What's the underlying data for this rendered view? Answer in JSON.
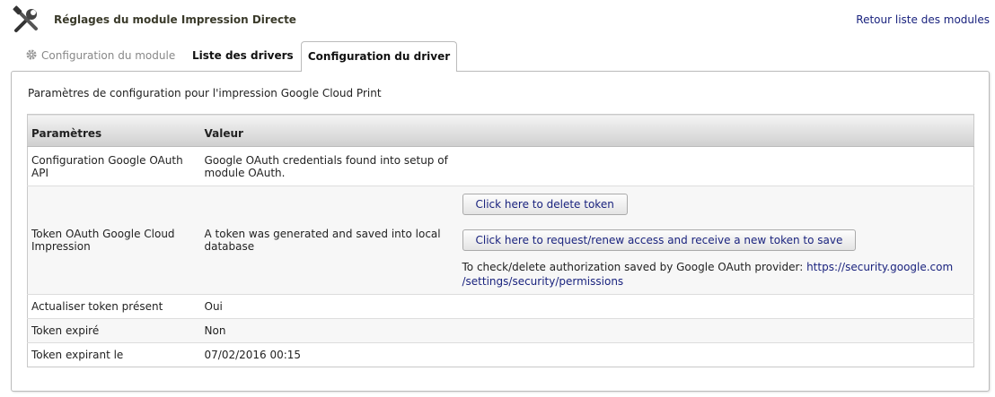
{
  "header": {
    "title": "Réglages du module Impression Directe",
    "back_link": "Retour liste des modules"
  },
  "tabs": [
    {
      "label": "Configuration du module",
      "state": "disabled",
      "icon": "gear-icon"
    },
    {
      "label": "Liste des drivers",
      "state": "inactive"
    },
    {
      "label": "Configuration du driver",
      "state": "active"
    }
  ],
  "panel": {
    "title": "Paramètres de configuration pour l'impression Google Cloud Print"
  },
  "table": {
    "headers": [
      "Paramètres",
      "Valeur"
    ],
    "rows": [
      {
        "param": "Configuration Google OAuth API",
        "value": "Google OAuth credentials found into setup of module OAuth."
      },
      {
        "param": "Token OAuth Google Cloud Impression",
        "value": "A token was generated and saved into local database"
      },
      {
        "param": "Actualiser token présent",
        "value": "Oui"
      },
      {
        "param": "Token expiré",
        "value": "Non"
      },
      {
        "param": "Token expirant le",
        "value": "07/02/2016 00:15"
      }
    ]
  },
  "token_actions": {
    "delete_button": "Click here to delete token",
    "renew_button": "Click here to request/renew access and receive a new token to save",
    "note_text": "To check/delete authorization saved by Google OAuth provider: ",
    "note_link_line1": "https://security.google.com",
    "note_link_line2": "/settings/security/permissions"
  },
  "colors": {
    "link": "#1a237e",
    "header_gradient_top": "#f4f4f4",
    "header_gradient_bottom": "#cfcfcf"
  }
}
